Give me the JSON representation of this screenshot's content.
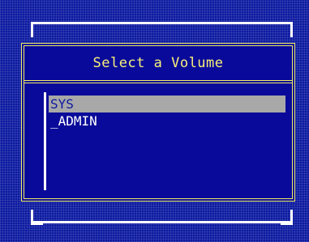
{
  "dialog": {
    "title": "Select a Volume",
    "volumes": [
      {
        "label": "SYS",
        "selected": true
      },
      {
        "label": "_ADMIN",
        "selected": false
      }
    ]
  },
  "colors": {
    "background": "#0c1aa0",
    "dialog_border": "#f2ef64",
    "title_text": "#f7f07a",
    "frame_lines": "#ffffff",
    "selection_bar": "#a8a8a8",
    "selected_text": "#0c1aa0",
    "item_text": "#ffffff"
  }
}
